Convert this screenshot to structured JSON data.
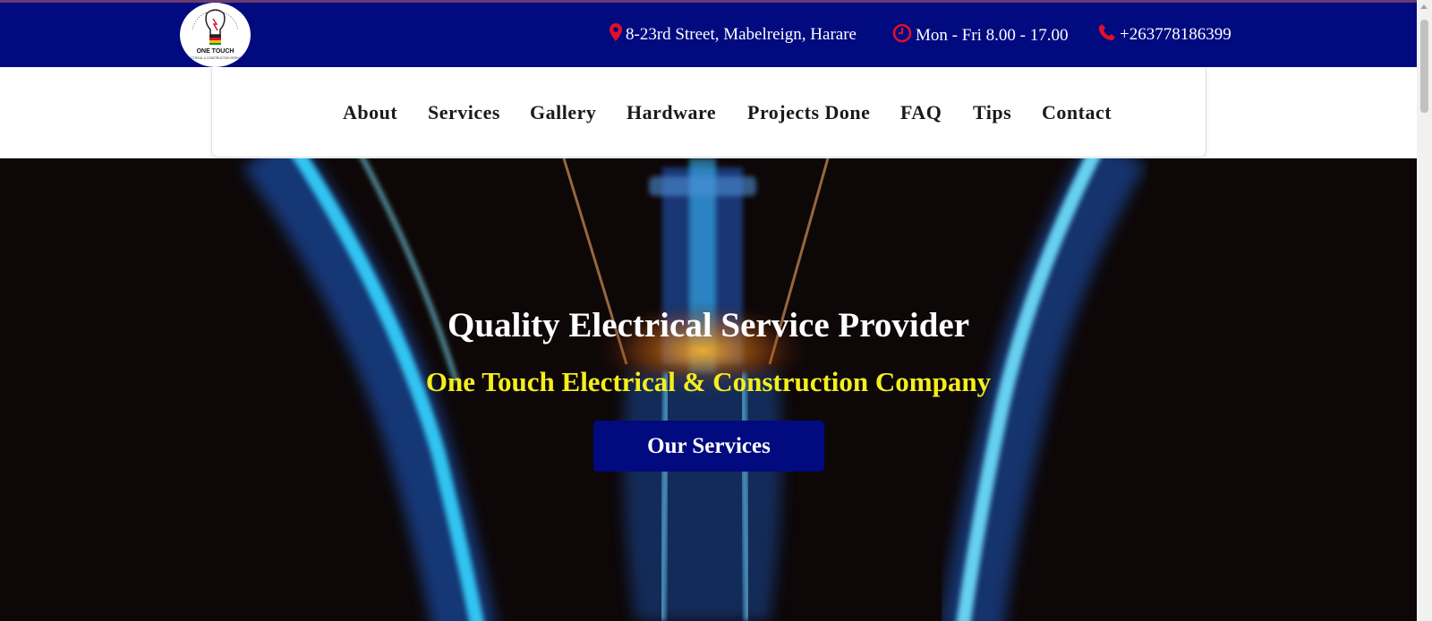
{
  "header": {
    "logo_text": "ONE TOUCH",
    "logo_subtext": "ELECTRICAL & CONSTRUCTION SERVICES",
    "address": "8-23rd Street, Mabelreign, Harare",
    "hours": "Mon - Fri 8.00 - 17.00",
    "phone": "+263778186399"
  },
  "nav": {
    "items": [
      "About",
      "Services",
      "Gallery",
      "Hardware",
      "Projects Done",
      "FAQ",
      "Tips",
      "Contact"
    ]
  },
  "hero": {
    "title": "Quality Electrical Service Provider",
    "subtitle": "One Touch Electrical & Construction Company",
    "button": "Our Services"
  },
  "colors": {
    "brand_navy": "#020a80",
    "accent_yellow": "#f4ee1d",
    "icon_red": "#e0102a",
    "nav_text": "#1a1a1a"
  },
  "icons": [
    "map-pin-icon",
    "clock-icon",
    "phone-icon"
  ]
}
